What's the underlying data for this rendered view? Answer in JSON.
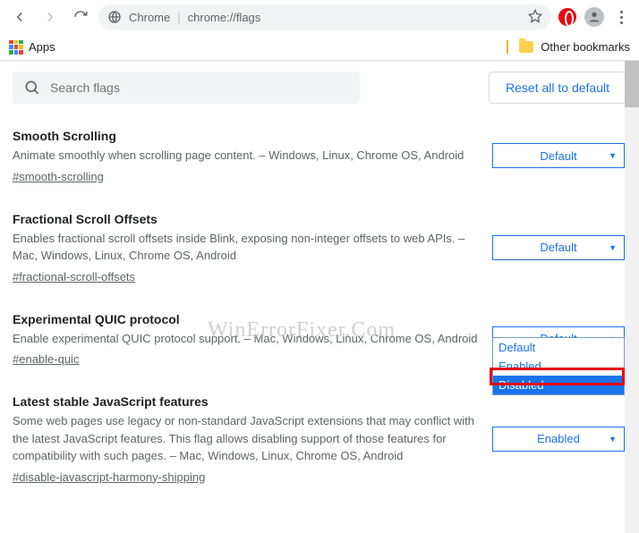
{
  "toolbar": {
    "addr_label": "Chrome",
    "addr_url": "chrome://flags"
  },
  "bookmarks": {
    "apps": "Apps",
    "other": "Other bookmarks"
  },
  "search": {
    "placeholder": "Search flags"
  },
  "reset_label": "Reset all to default",
  "watermark": "WinErrorFixer.Com",
  "flags": [
    {
      "title": "Smooth Scrolling",
      "desc": "Animate smoothly when scrolling page content. – Windows, Linux, Chrome OS, Android",
      "anchor": "#smooth-scrolling",
      "value": "Default"
    },
    {
      "title": "Fractional Scroll Offsets",
      "desc": "Enables fractional scroll offsets inside Blink, exposing non-integer offsets to web APIs. – Mac, Windows, Linux, Chrome OS, Android",
      "anchor": "#fractional-scroll-offsets",
      "value": "Default"
    },
    {
      "title": "Experimental QUIC protocol",
      "desc": "Enable experimental QUIC protocol support. – Mac, Windows, Linux, Chrome OS, Android",
      "anchor": "#enable-quic",
      "value": "Default",
      "options": [
        "Default",
        "Enabled",
        "Disabled"
      ],
      "active": "Disabled"
    },
    {
      "title": "Latest stable JavaScript features",
      "desc": "Some web pages use legacy or non-standard JavaScript extensions that may conflict with the latest JavaScript features. This flag allows disabling support of those features for compatibility with such pages. – Mac, Windows, Linux, Chrome OS, Android",
      "anchor": "#disable-javascript-harmony-shipping",
      "value": "Enabled"
    }
  ]
}
